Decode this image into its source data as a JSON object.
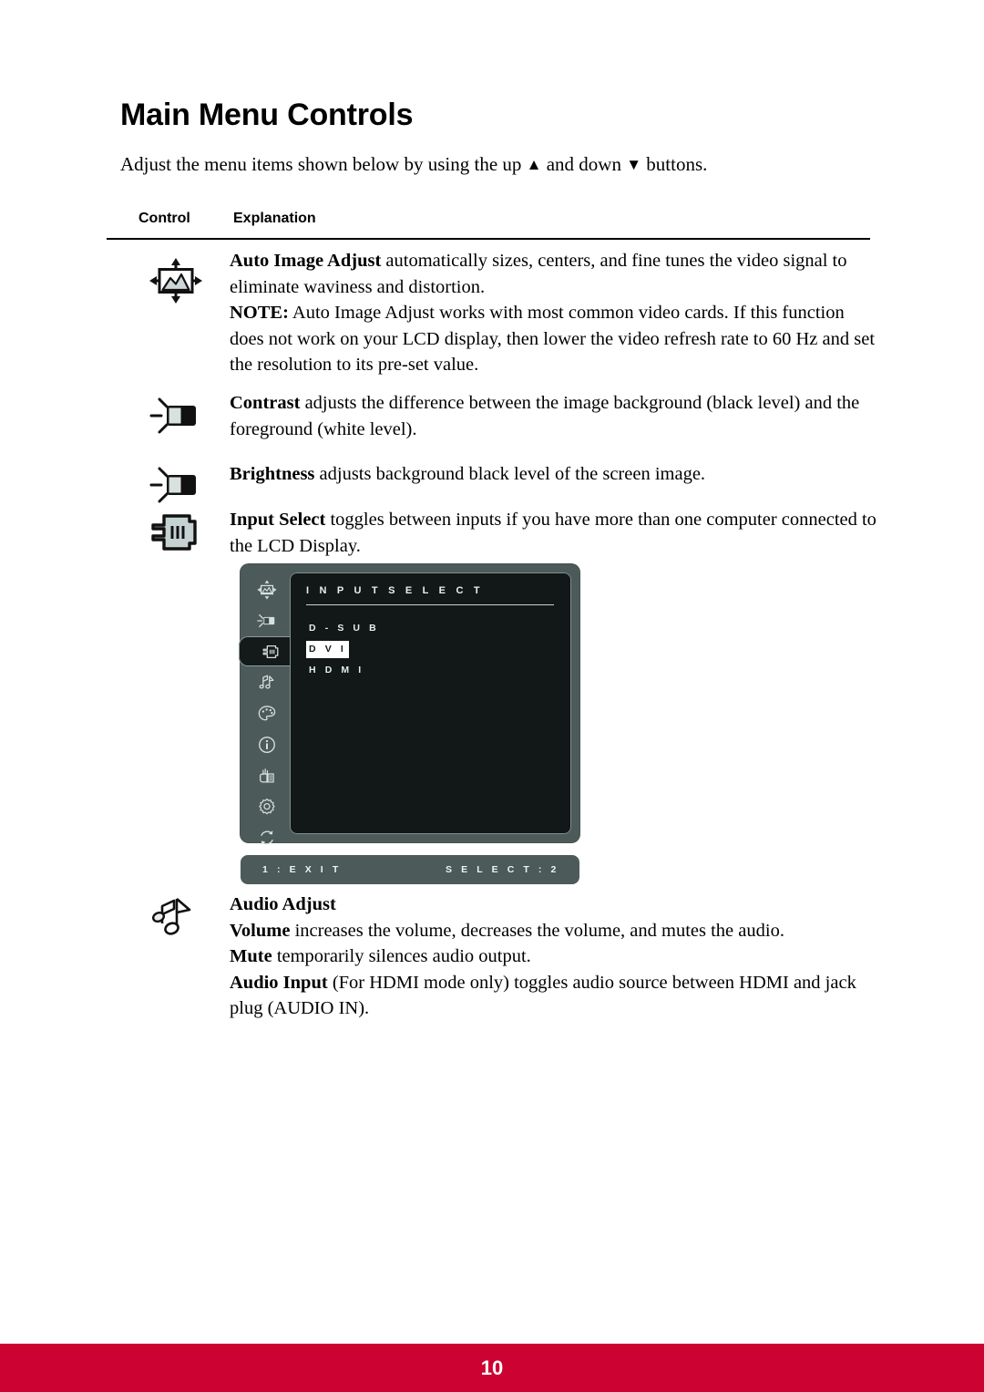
{
  "page": {
    "title": "Main Menu Controls",
    "intro_before": "Adjust the menu items shown below by using the up ",
    "intro_up_glyph": "▲",
    "intro_middle": " and down ",
    "intro_down_glyph": "▼",
    "intro_after": " buttons.",
    "page_number": "10",
    "footer_color": "#cc0233"
  },
  "table": {
    "col_control": "Control",
    "col_explanation": "Explanation"
  },
  "rows": {
    "auto_image_adjust": {
      "icon_name": "auto-image-adjust-icon",
      "term": "Auto Image Adjust",
      "body": " automatically sizes, centers, and fine tunes the video signal to eliminate waviness and distortion.",
      "note_label": "NOTE:",
      "note_body": " Auto Image Adjust works with most common video cards. If this function does not work on your LCD display, then lower the video refresh rate to 60 Hz and set the resolution to its pre-set value."
    },
    "contrast": {
      "icon_name": "contrast-icon",
      "term": "Contrast",
      "body": " adjusts the difference between the image background  (black level) and the foreground (white level)."
    },
    "brightness": {
      "icon_name": "brightness-icon",
      "term": "Brightness",
      "body": " adjusts background black level of the screen image."
    },
    "input_select": {
      "icon_name": "input-select-icon",
      "term": "Input Select",
      "body": " toggles between inputs if you have more than one computer connected to the LCD Display."
    },
    "audio_adjust": {
      "icon_name": "audio-adjust-icon",
      "heading": "Audio Adjust",
      "volume_term": "Volume",
      "volume_body": " increases the volume, decreases the volume, and mutes the audio.",
      "mute_term": "Mute",
      "mute_body": " temporarily silences audio output.",
      "audio_input_term": "Audio Input",
      "audio_input_body": " (For HDMI mode only) toggles audio source between HDMI and jack plug (AUDIO IN)."
    }
  },
  "osd": {
    "title": "I N P U T   S E L E C T",
    "options": [
      {
        "label": "D - S U B",
        "selected": false
      },
      {
        "label": "D V I",
        "selected": true
      },
      {
        "label": "H D M I",
        "selected": false
      }
    ],
    "footer_left": "1 : E X I T",
    "footer_right": "S E L E C T : 2",
    "sidebar_icons": [
      "auto-image-adjust-icon",
      "contrast-icon",
      "input-select-icon",
      "audio-adjust-icon",
      "color-adjust-icon",
      "information-icon",
      "manual-image-adjust-icon",
      "setup-menu-icon",
      "memory-recall-icon"
    ],
    "active_index": 2,
    "panel_color": "#4c5a59",
    "screen_color": "#121717",
    "text_color": "#e8f0ee"
  }
}
